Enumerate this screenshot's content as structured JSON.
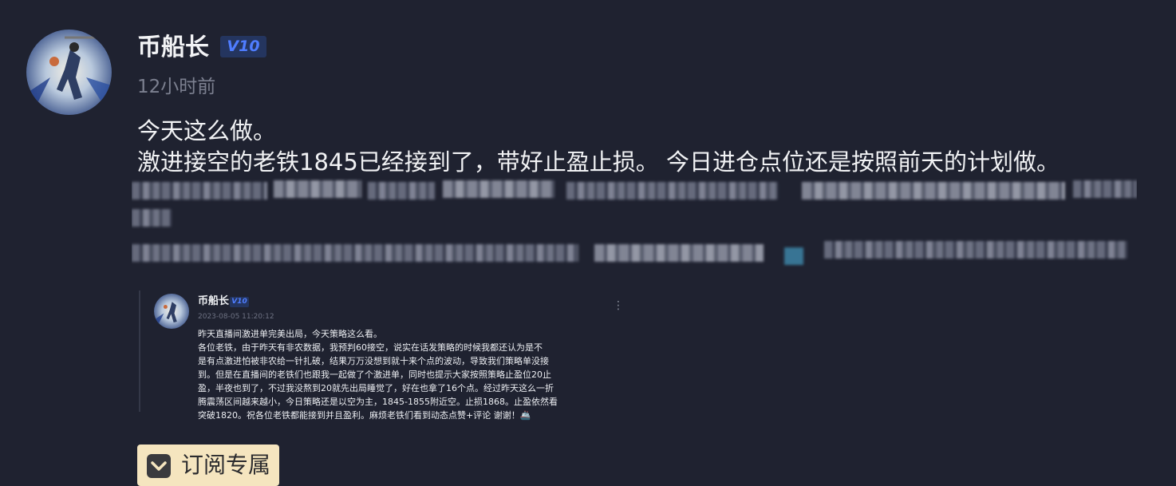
{
  "author": {
    "name": "币船长",
    "badge": "V10",
    "time": "12小时前"
  },
  "post": {
    "line1": "今天这么做。",
    "line2": "激进接空的老铁1845已经接到了，带好止盈止损。 今日进仓点位还是按照前天的计划做。"
  },
  "shared_post": {
    "name": "币船长",
    "badge": "V10",
    "date": "2023-08-05 11:20:12",
    "more_icon": "⋮",
    "lines": [
      "昨天直播间激进单完美出局，今天策略这么看。",
      "各位老铁，由于昨天有非农数据，我预判60接空，说实在话发策略的时候我都还认为是不",
      "是有点激进怕被非农给一针扎破，结果万万没想到就十来个点的波动，导致我们策略单没接",
      "到。但是在直播间的老铁们也跟我一起做了个激进单，同时也提示大家按照策略止盈位20止",
      "盈，半夜也到了，不过我没熬到20就先出局睡觉了，好在也拿了16个点。经过昨天这么一折",
      "腾震荡区间越来越小，今日策略还是以空为主，1845-1855附近空。止损1868。止盈依然看",
      "突破1820。祝各位老铁都能接到并且盈利。麻烦老铁们看到动态点赞+评论 谢谢！🚢"
    ]
  },
  "subscribe": {
    "label": "订阅专属",
    "icon": "heart-chevron-icon"
  },
  "colors": {
    "background": "#1f2230",
    "badge_bg": "#24355f",
    "badge_text": "#4f7dff",
    "subscribe_bg": "#f5e5bf"
  }
}
